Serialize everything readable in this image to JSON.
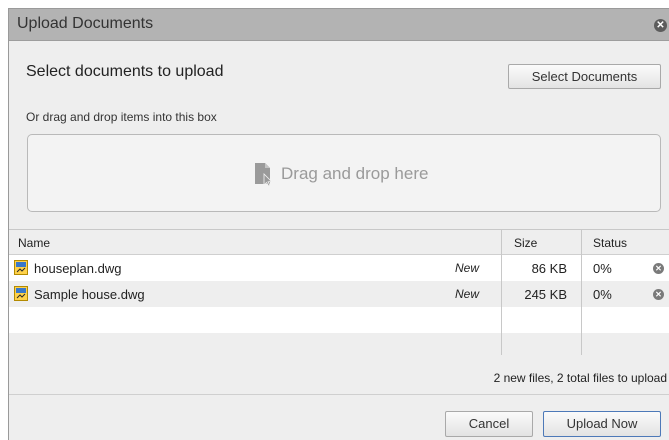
{
  "dialog": {
    "title": "Upload Documents",
    "close_icon": "close-icon"
  },
  "header": {
    "heading": "Select documents to upload",
    "select_button": "Select Documents"
  },
  "dropzone": {
    "hint": "Or drag and drop items into this box",
    "text": "Drag and drop here",
    "icon": "document-cursor-icon"
  },
  "table": {
    "columns": {
      "name": "Name",
      "size": "Size",
      "status": "Status"
    },
    "rows": [
      {
        "name": "houseplan.dwg",
        "badge": "New",
        "size": "86 KB",
        "status": "0%"
      },
      {
        "name": "Sample house.dwg",
        "badge": "New",
        "size": "245 KB",
        "status": "0%"
      }
    ]
  },
  "summary": "2 new files, 2 total files to upload",
  "footer": {
    "cancel": "Cancel",
    "upload": "Upload Now"
  },
  "colors": {
    "titlebar": "#b3b3b3",
    "dialog_bg": "#eeeeee",
    "primary_border": "#4d79b8"
  }
}
